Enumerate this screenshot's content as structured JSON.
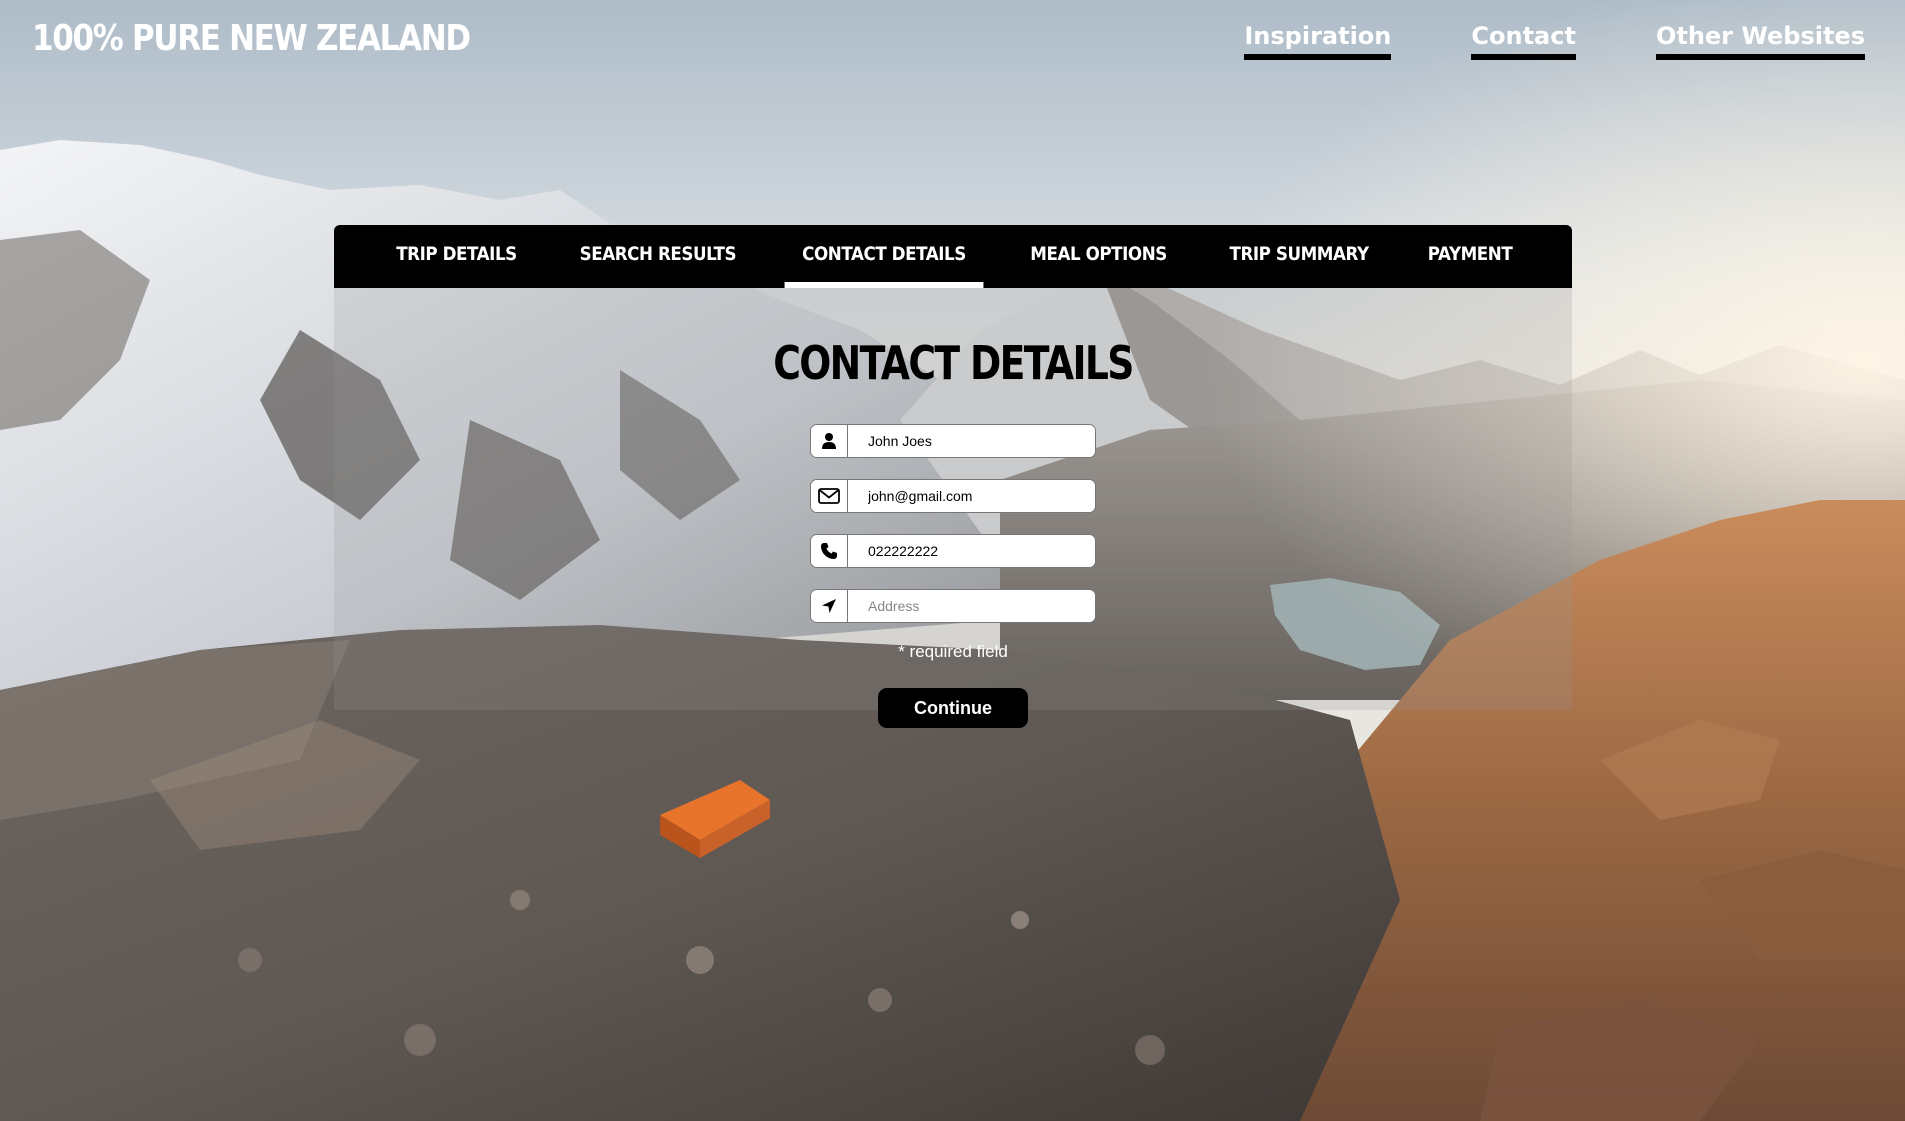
{
  "header": {
    "logo_text": "100% PURE NEW ZEALAND",
    "nav": [
      {
        "label": "Inspiration"
      },
      {
        "label": "Contact"
      },
      {
        "label": "Other Websites"
      }
    ]
  },
  "tabs": [
    {
      "label": "TRIP DETAILS",
      "active": false
    },
    {
      "label": "SEARCH RESULTS",
      "active": false
    },
    {
      "label": "CONTACT DETAILS",
      "active": true
    },
    {
      "label": "MEAL OPTIONS",
      "active": false
    },
    {
      "label": "TRIP SUMMARY",
      "active": false
    },
    {
      "label": "PAYMENT",
      "active": false
    }
  ],
  "form": {
    "title": "CONTACT DETAILS",
    "fields": {
      "name": {
        "icon": "user-icon",
        "value": "John Joes",
        "placeholder": ""
      },
      "email": {
        "icon": "envelope-icon",
        "value": "john@gmail.com",
        "placeholder": ""
      },
      "phone": {
        "icon": "phone-icon",
        "value": "022222222",
        "placeholder": ""
      },
      "address": {
        "icon": "location-arrow-icon",
        "value": "",
        "placeholder": "Address"
      }
    },
    "required_note": "* required field",
    "continue_label": "Continue"
  },
  "colors": {
    "nav_underline": "#000000",
    "tab_bar": "#000000",
    "active_tab_indicator": "#ffffff",
    "button": "#000000"
  }
}
